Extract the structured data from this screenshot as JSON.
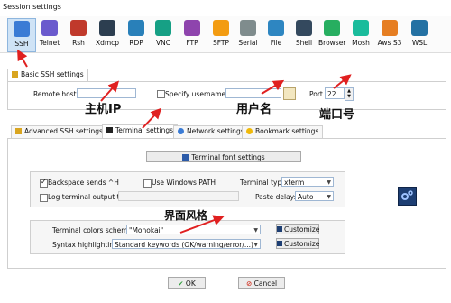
{
  "window": {
    "title": "Session settings"
  },
  "toolbar": {
    "items": [
      {
        "label": "SSH",
        "icon": "ssh-icon",
        "color": "#3a7bd5"
      },
      {
        "label": "Telnet",
        "icon": "telnet-icon",
        "color": "#6a5acd"
      },
      {
        "label": "Rsh",
        "icon": "rsh-icon",
        "color": "#c0392b"
      },
      {
        "label": "Xdmcp",
        "icon": "xdmcp-icon",
        "color": "#2c3e50"
      },
      {
        "label": "RDP",
        "icon": "rdp-icon",
        "color": "#2980b9"
      },
      {
        "label": "VNC",
        "icon": "vnc-icon",
        "color": "#16a085"
      },
      {
        "label": "FTP",
        "icon": "ftp-icon",
        "color": "#8e44ad"
      },
      {
        "label": "SFTP",
        "icon": "sftp-icon",
        "color": "#f39c12"
      },
      {
        "label": "Serial",
        "icon": "serial-icon",
        "color": "#7f8c8d"
      },
      {
        "label": "File",
        "icon": "file-icon",
        "color": "#2e86c1"
      },
      {
        "label": "Shell",
        "icon": "shell-icon",
        "color": "#34495e"
      },
      {
        "label": "Browser",
        "icon": "browser-icon",
        "color": "#27ae60"
      },
      {
        "label": "Mosh",
        "icon": "mosh-icon",
        "color": "#1abc9c"
      },
      {
        "label": "Aws S3",
        "icon": "aws-s3-icon",
        "color": "#e67e22"
      },
      {
        "label": "WSL",
        "icon": "wsl-icon",
        "color": "#2471a3"
      }
    ]
  },
  "basic": {
    "tab_label": "Basic SSH settings",
    "remote_host_label": "Remote host *",
    "remote_host_value": "",
    "specify_username_label": "Specify username",
    "username_value": "",
    "port_label": "Port",
    "port_value": "22"
  },
  "tabs": [
    {
      "label": "Advanced SSH settings",
      "active": false
    },
    {
      "label": "Terminal settings",
      "active": true
    },
    {
      "label": "Network settings",
      "active": false
    },
    {
      "label": "Bookmark settings",
      "active": false
    }
  ],
  "terminal": {
    "font_button": "Terminal font settings",
    "backspace_label": "Backspace sends ^H",
    "backspace_checked": true,
    "windows_path_label": "Use Windows PATH",
    "windows_path_checked": false,
    "terminal_type_label": "Terminal type:",
    "terminal_type_value": "xterm",
    "log_output_label": "Log terminal output to:",
    "log_output_checked": false,
    "paste_delay_label": "Paste delay:",
    "paste_delay_value": "Auto",
    "colors_label": "Terminal colors scheme:",
    "colors_value": "\"Monokai\"",
    "customize_label": "Customize",
    "syntax_label": "Syntax highlighting:",
    "syntax_value": "Standard keywords (OK/warning/error/...)",
    "customize2_label": "Customize"
  },
  "footer": {
    "ok_label": "OK",
    "cancel_label": "Cancel"
  },
  "annotations": {
    "host_ip": "主机IP",
    "username": "用户名",
    "port": "端口号",
    "ui_style": "界面风格"
  },
  "colors": {
    "accent": "#cfe3f6",
    "arrow": "#e02020",
    "ok_green": "#2e9e3a",
    "cancel_red": "#d23a2a"
  }
}
